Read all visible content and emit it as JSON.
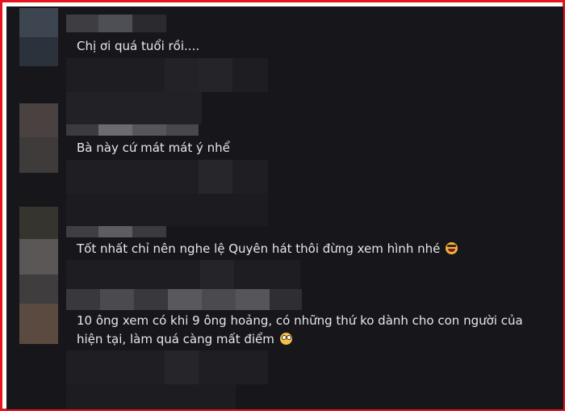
{
  "comments": [
    {
      "text": "Chị ơi quá tuổi rồi....",
      "emoji": ""
    },
    {
      "text": "Bà này cứ mát mát ý nhể",
      "emoji": ""
    },
    {
      "text": "Tốt nhất chỉ nên nghe lệ Quyên hát thôi đừng xem hình nhé",
      "emoji": "laughing-face-emoji"
    },
    {
      "text_line1": "10 ông xem có khi 9 ông hoảng, có những thứ ko dành cho con người của",
      "text_line2": "hiện tại, làm quá càng mất điểm",
      "emoji": "flushed-face-emoji"
    }
  ],
  "colors": {
    "frame_border": "#e8141b",
    "background": "#17171b",
    "text": "#e6e7e9"
  }
}
